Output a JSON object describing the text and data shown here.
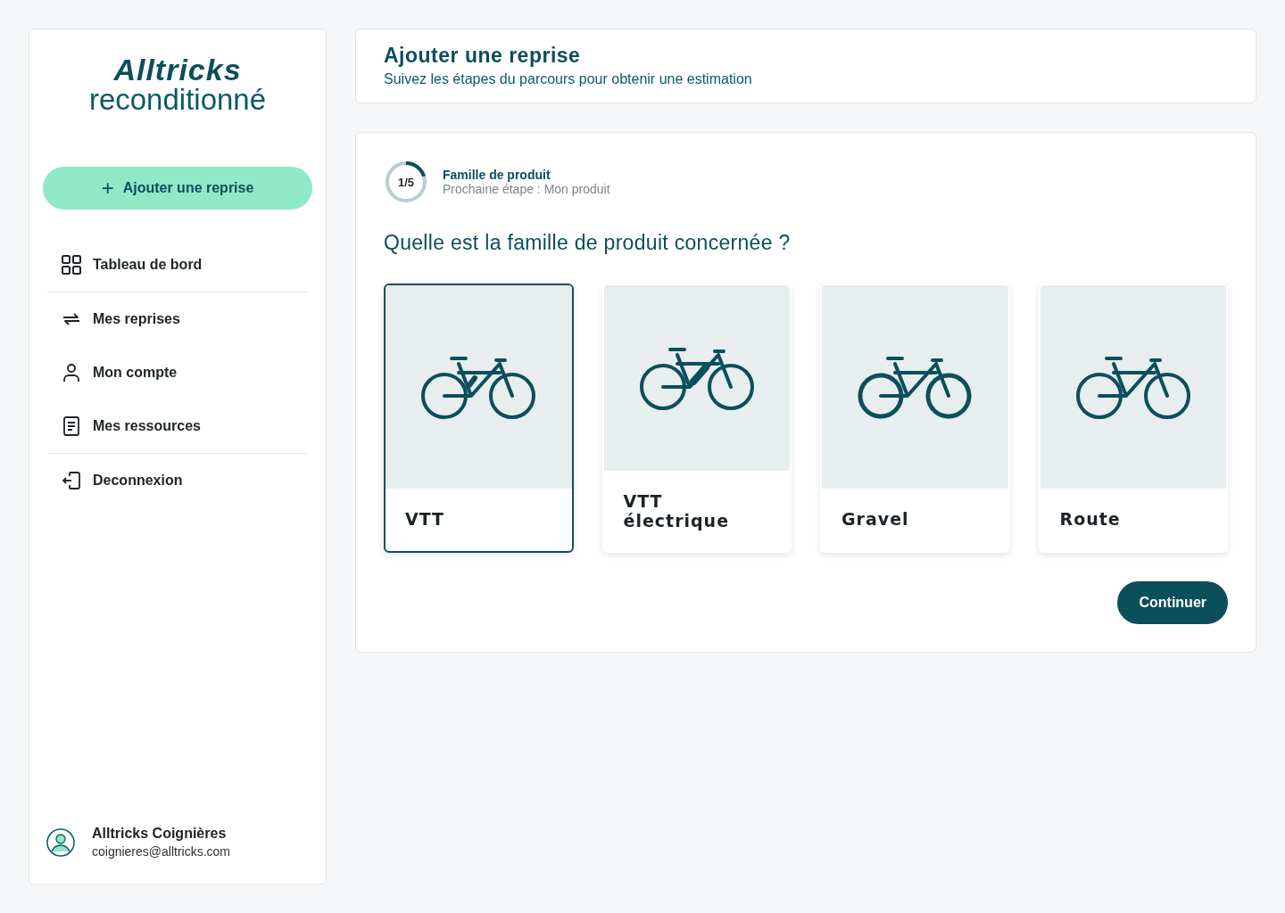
{
  "sidebar": {
    "logo": {
      "brand": "Alltricks",
      "subtitle": "reconditionné"
    },
    "add_button": {
      "icon": "+",
      "label": "Ajouter une reprise"
    },
    "nav_groups": [
      [
        {
          "kind": "dashboard",
          "label": "Tableau de bord"
        }
      ],
      [
        {
          "kind": "swap",
          "label": "Mes reprises"
        },
        {
          "kind": "user",
          "label": "Mon compte"
        },
        {
          "kind": "document",
          "label": "Mes ressources"
        }
      ],
      [
        {
          "kind": "logout",
          "label": "Deconnexion"
        }
      ]
    ],
    "user": {
      "name": "Alltricks Coignières",
      "email": "coignieres@alltricks.com"
    }
  },
  "header": {
    "title": "Ajouter une reprise",
    "subtitle": "Suivez les étapes du parcours pour obtenir une estimation"
  },
  "step": {
    "counter": "1/5",
    "level": 0.2,
    "title": "Famille de produit",
    "next": "Prochaine étape : Mon produit"
  },
  "question": "Quelle est la famille de produit concernée ?",
  "options": [
    {
      "kind": "mtb",
      "label": "VTT",
      "selected": true
    },
    {
      "kind": "ebike",
      "label": "VTT électrique",
      "selected": false
    },
    {
      "kind": "gravel",
      "label": "Gravel",
      "selected": false
    },
    {
      "kind": "road",
      "label": "Route",
      "selected": false
    }
  ],
  "continue_button": "Continuer"
}
